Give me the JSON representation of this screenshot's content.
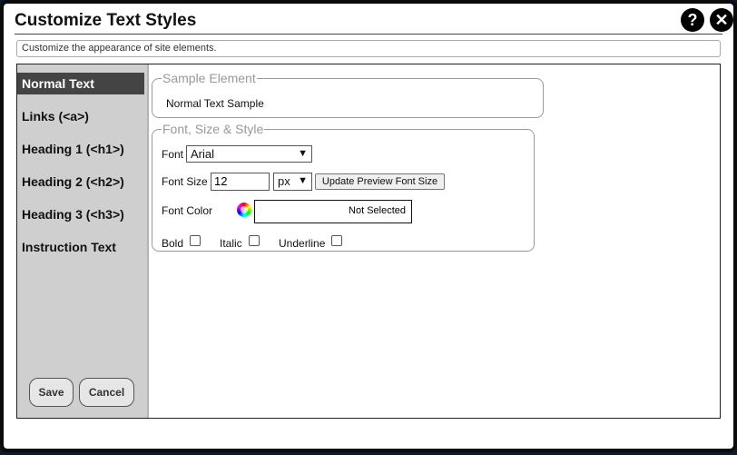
{
  "dialog": {
    "title": "Customize Text Styles",
    "help_label": "?",
    "close_label": "✕",
    "description": "Customize the appearance of site elements."
  },
  "sidebar": {
    "items": [
      {
        "label": "Normal Text"
      },
      {
        "label": "Links (<a>)"
      },
      {
        "label": "Heading 1 (<h1>)"
      },
      {
        "label": "Heading 2 (<h2>)"
      },
      {
        "label": "Heading 3 (<h3>)"
      },
      {
        "label": "Instruction Text"
      }
    ],
    "active_index": 0,
    "save_label": "Save",
    "cancel_label": "Cancel"
  },
  "sample": {
    "legend": "Sample Element",
    "text": "Normal Text Sample"
  },
  "style": {
    "legend": "Font, Size & Style",
    "font_label": "Font",
    "font_value": "Arial",
    "size_label": "Font Size",
    "size_value": "12",
    "unit_value": "px",
    "update_label": "Update Preview Font Size",
    "color_label": "Font Color",
    "color_value": "Not Selected",
    "bold_label": "Bold",
    "italic_label": "Italic",
    "underline_label": "Underline"
  },
  "icons": {
    "help": "help-icon",
    "close": "close-icon",
    "color_picker": "color-wheel-icon",
    "dropdown": "chevron-down-icon"
  }
}
